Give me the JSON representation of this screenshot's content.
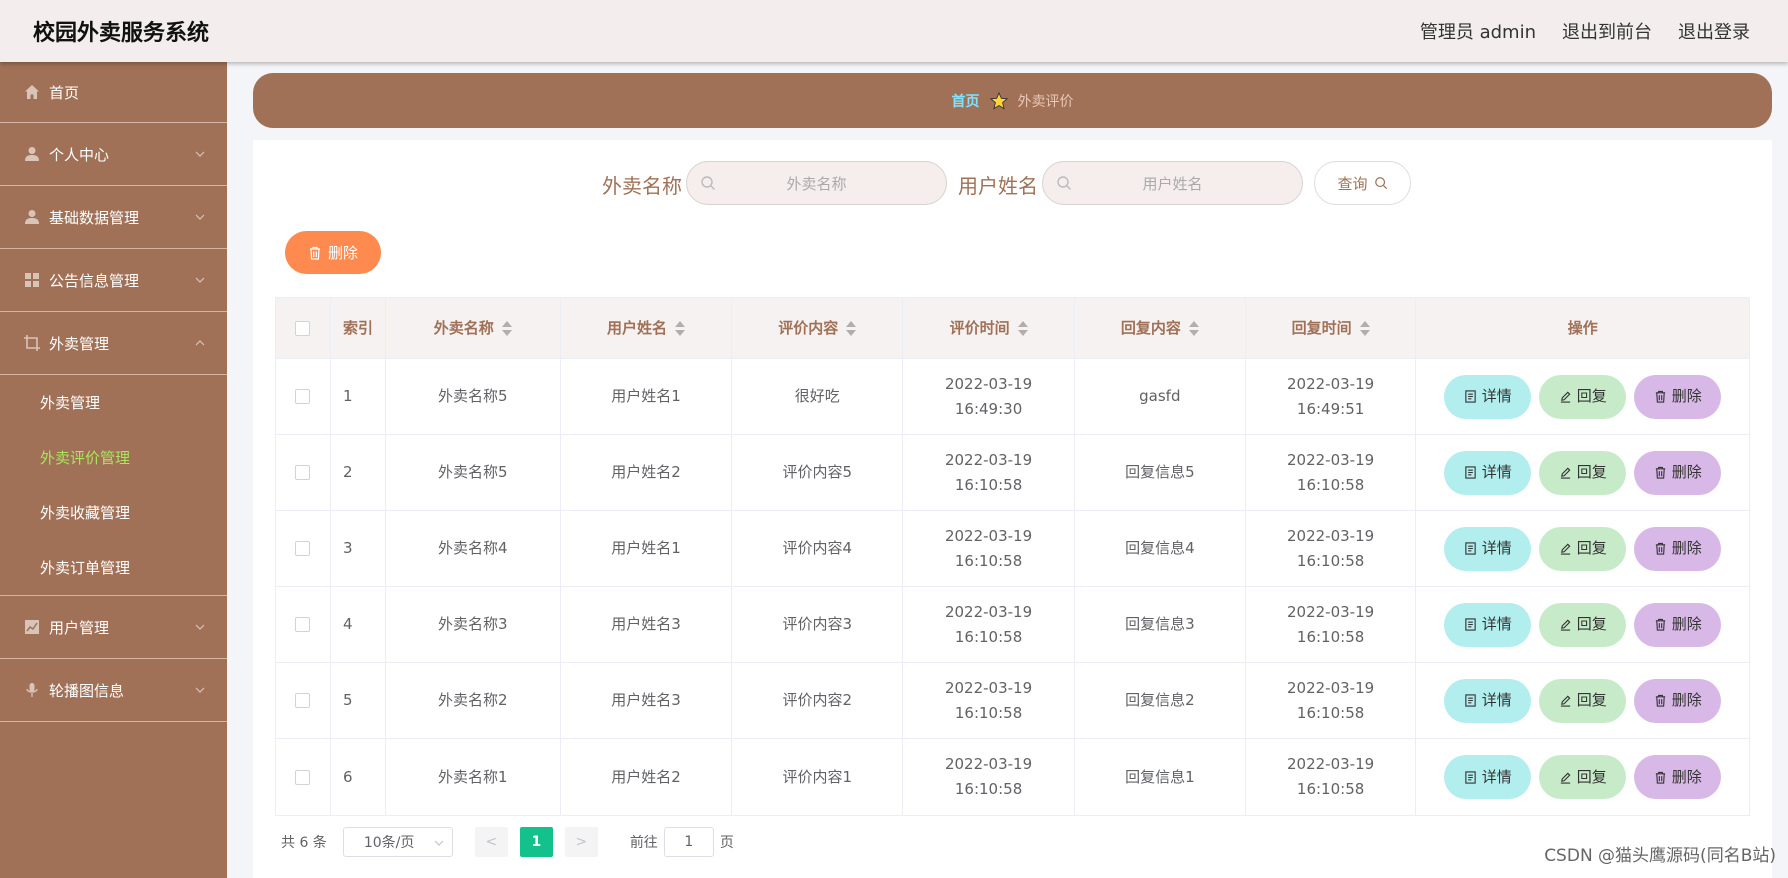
{
  "header": {
    "title": "校园外卖服务系统",
    "user": "管理员 admin",
    "to_front": "退出到前台",
    "logout": "退出登录"
  },
  "sidebar": {
    "items": [
      {
        "label": "首页",
        "icon": "home-icon"
      },
      {
        "label": "个人中心",
        "icon": "user-icon"
      },
      {
        "label": "基础数据管理",
        "icon": "user-icon"
      },
      {
        "label": "公告信息管理",
        "icon": "grid-icon"
      },
      {
        "label": "外卖管理",
        "icon": "crop-icon"
      },
      {
        "label": "用户管理",
        "icon": "chart-icon"
      },
      {
        "label": "轮播图信息",
        "icon": "microphone-icon"
      }
    ],
    "submenu": [
      "外卖管理",
      "外卖评价管理",
      "外卖收藏管理",
      "外卖订单管理"
    ],
    "active_sub": "外卖评价管理"
  },
  "breadcrumb": {
    "home": "首页",
    "current": "外卖评价"
  },
  "search": {
    "name_label": "外卖名称",
    "name_placeholder": "外卖名称",
    "user_label": "用户姓名",
    "user_placeholder": "用户姓名",
    "button": "查询"
  },
  "toolbar": {
    "delete": "删除"
  },
  "table": {
    "columns": [
      "索引",
      "外卖名称",
      "用户姓名",
      "评价内容",
      "评价时间",
      "回复内容",
      "回复时间",
      "操作"
    ],
    "rows": [
      {
        "index": "1",
        "name": "外卖名称5",
        "user": "用户姓名1",
        "content": "很好吃",
        "time": "2022-03-19 16:49:30",
        "reply": "gasfd",
        "reply_time": "2022-03-19 16:49:51"
      },
      {
        "index": "2",
        "name": "外卖名称5",
        "user": "用户姓名2",
        "content": "评价内容5",
        "time": "2022-03-19 16:10:58",
        "reply": "回复信息5",
        "reply_time": "2022-03-19 16:10:58"
      },
      {
        "index": "3",
        "name": "外卖名称4",
        "user": "用户姓名1",
        "content": "评价内容4",
        "time": "2022-03-19 16:10:58",
        "reply": "回复信息4",
        "reply_time": "2022-03-19 16:10:58"
      },
      {
        "index": "4",
        "name": "外卖名称3",
        "user": "用户姓名3",
        "content": "评价内容3",
        "time": "2022-03-19 16:10:58",
        "reply": "回复信息3",
        "reply_time": "2022-03-19 16:10:58"
      },
      {
        "index": "5",
        "name": "外卖名称2",
        "user": "用户姓名3",
        "content": "评价内容2",
        "time": "2022-03-19 16:10:58",
        "reply": "回复信息2",
        "reply_time": "2022-03-19 16:10:58"
      },
      {
        "index": "6",
        "name": "外卖名称1",
        "user": "用户姓名2",
        "content": "评价内容1",
        "time": "2022-03-19 16:10:58",
        "reply": "回复信息1",
        "reply_time": "2022-03-19 16:10:58"
      }
    ],
    "actions": {
      "detail": "详情",
      "reply": "回复",
      "delete": "删除"
    }
  },
  "pager": {
    "total": "共 6 条",
    "page_size": "10条/页",
    "prev": "<",
    "current_page": "1",
    "next": ">",
    "goto": "前往",
    "goto_value": "1",
    "page_unit": "页"
  },
  "watermark": "CSDN @猫头鹰源码(同名B站)",
  "colors": {
    "primary": "#a07157",
    "active_menu": "#a8e65a",
    "breadcrumb_home": "#7fe3ff",
    "delete_button": "#ff8a50",
    "page_active": "#13c18d",
    "detail_btn": "#b2eeee",
    "reply_btn": "#c7ebc8",
    "row_delete_btn": "#d8b8e6"
  }
}
